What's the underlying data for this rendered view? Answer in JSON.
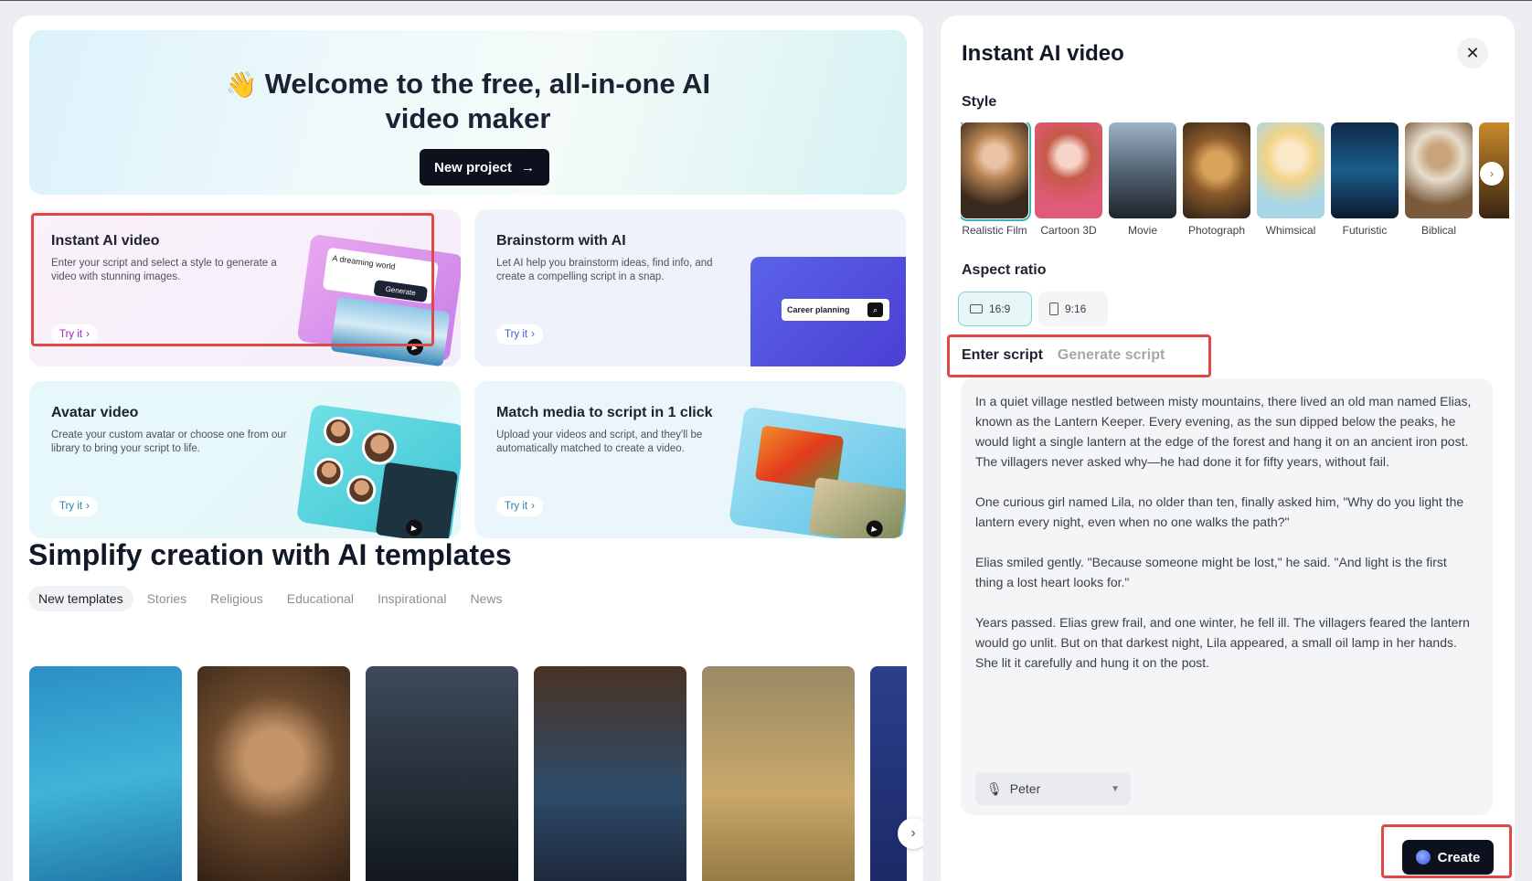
{
  "home": {
    "hero": {
      "wave_emoji": "👋",
      "title_line1": "Welcome to the free, all-in-one AI",
      "title_line2": "video maker",
      "new_project_label": "New project"
    },
    "cards": [
      {
        "title": "Instant AI video",
        "description": "Enter your script and select a style to generate a video with stunning images.",
        "try_label": "Try it",
        "note": "A dreaming world",
        "generate_label": "Generate"
      },
      {
        "title": "Brainstorm with AI",
        "description": "Let AI help you brainstorm ideas, find info, and create a compelling script in a snap.",
        "try_label": "Try it",
        "input_text": "Career planning"
      },
      {
        "title": "Avatar video",
        "description": "Create your custom avatar or choose one from our library to bring your script to life.",
        "try_label": "Try it"
      },
      {
        "title": "Match media to script in 1 click",
        "description": "Upload your videos and script, and they'll be automatically matched to create a video.",
        "try_label": "Try it"
      }
    ],
    "templates_title": "Simplify creation with AI templates",
    "template_tabs": [
      "New templates",
      "Stories",
      "Religious",
      "Educational",
      "Inspirational",
      "News"
    ]
  },
  "panel": {
    "title": "Instant AI video",
    "style_label": "Style",
    "styles": [
      "Realistic Film",
      "Cartoon 3D",
      "Movie",
      "Photograph",
      "Whimsical",
      "Futuristic",
      "Biblical"
    ],
    "selected_style": "Realistic Film",
    "aspect_label": "Aspect ratio",
    "aspect_options": [
      "16:9",
      "9:16"
    ],
    "selected_aspect": "16:9",
    "script_tabs": [
      "Enter script",
      "Generate script"
    ],
    "script_text": "In a quiet village nestled between misty mountains, there lived an old man named Elias, known as the Lantern Keeper. Every evening, as the sun dipped below the peaks, he would light a single lantern at the edge of the forest and hang it on an ancient iron post. The villagers never asked why—he had done it for fifty years, without fail.\n\nOne curious girl named Lila, no older than ten, finally asked him, \"Why do you light the lantern every night, even when no one walks the path?\"\n\nElias smiled gently. \"Because someone might be lost,\" he said. \"And light is the first thing a lost heart looks for.\"\n\nYears passed. Elias grew frail, and one winter, he fell ill. The villagers feared the lantern would go unlit. But on that darkest night, Lila appeared, a small oil lamp in her hands. She lit it carefully and hung it on the post.",
    "voice": "Peter",
    "create_label": "Create"
  }
}
